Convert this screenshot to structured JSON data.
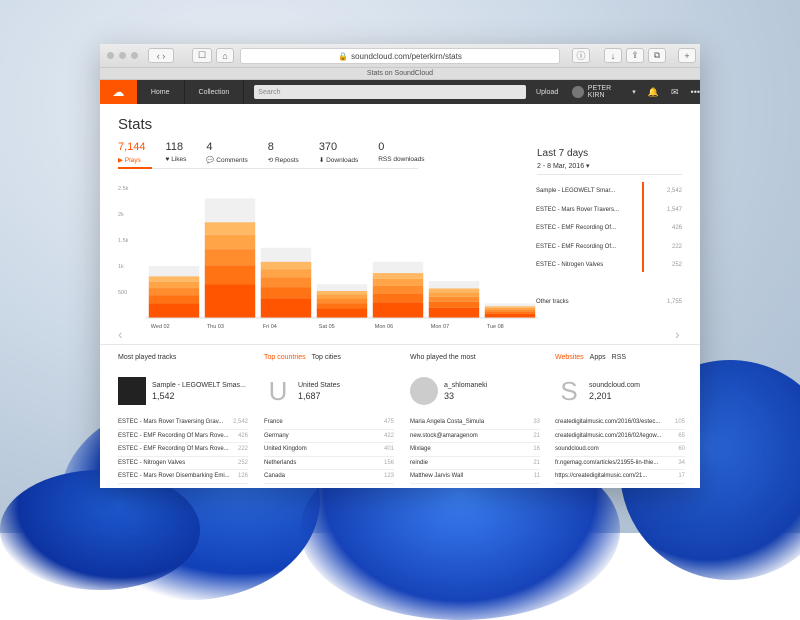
{
  "browser": {
    "url": "soundcloud.com/peterkirn/stats",
    "tab_title": "Stats on SoundCloud"
  },
  "nav": {
    "home": "Home",
    "collection": "Collection",
    "search_placeholder": "Search",
    "upload": "Upload",
    "user": "PETER KIRN"
  },
  "stats": {
    "title": "Stats",
    "counts": [
      {
        "num": "7,144",
        "label": "▶ Plays"
      },
      {
        "num": "118",
        "label": "♥ Likes"
      },
      {
        "num": "4",
        "label": "💬 Comments"
      },
      {
        "num": "8",
        "label": "⟲ Reposts"
      },
      {
        "num": "370",
        "label": "⬇ Downloads"
      },
      {
        "num": "0",
        "label": "RSS downloads"
      }
    ],
    "range_title": "Last 7 days",
    "range_sub": "2 - 8 Mar, 2016 ▾"
  },
  "chart_data": {
    "type": "bar",
    "categories": [
      "Wed 02",
      "Thu 03",
      "Fri 04",
      "Sat 05",
      "Mon 06",
      "Mon 07",
      "Tue 08"
    ],
    "series": [
      {
        "values": [
          1000,
          2300,
          1350,
          650,
          1080,
          710,
          280
        ]
      }
    ],
    "yticks": [
      "500",
      "1k",
      "1.5k",
      "2k",
      "2.5k"
    ],
    "ylim": [
      0,
      2500
    ],
    "colors": [
      "#ff5500",
      "#ff7315",
      "#ff8d2d",
      "#ffa447",
      "#ffb864",
      "#f0f0f0"
    ]
  },
  "track_breakdown": [
    {
      "name": "Sample - LEGOWELT Smar...",
      "value": "2,542"
    },
    {
      "name": "ESTEC - Mars Rover Travers...",
      "value": "1,547"
    },
    {
      "name": "ESTEC - EMF Recording Of...",
      "value": "426"
    },
    {
      "name": "ESTEC - EMF Recording Of...",
      "value": "222"
    },
    {
      "name": "ESTEC - Nitrogen Valves",
      "value": "252"
    },
    {
      "name": "Other tracks",
      "value": "1,755"
    }
  ],
  "most_played": {
    "header": "Most played tracks",
    "top_name": "Sample - LEGOWELT Smas...",
    "top_value": "1,542",
    "rows": [
      {
        "name": "ESTEC - Mars Rover Traversing Grav...",
        "value": "2,542"
      },
      {
        "name": "ESTEC - EMF Recording Of Mars Rove...",
        "value": "426"
      },
      {
        "name": "ESTEC - EMF Recording Of Mars Rove...",
        "value": "222"
      },
      {
        "name": "ESTEC - Nitrogen Valves",
        "value": "252"
      },
      {
        "name": "ESTEC - Mars Rover Disembarking Emi...",
        "value": "126"
      }
    ]
  },
  "countries": {
    "tab_active": "Top countries",
    "tab_other": "Top cities",
    "letter": "U",
    "top_name": "United States",
    "top_value": "1,687",
    "rows": [
      {
        "name": "France",
        "value": "475"
      },
      {
        "name": "Germany",
        "value": "422"
      },
      {
        "name": "United Kingdom",
        "value": "401"
      },
      {
        "name": "Netherlands",
        "value": "156"
      },
      {
        "name": "Canada",
        "value": "123"
      }
    ]
  },
  "who_played": {
    "header": "Who played the most",
    "top_name": "a_shlomaneki",
    "top_value": "33",
    "rows": [
      {
        "name": "Maria Angela Costa_Simula",
        "value": "33"
      },
      {
        "name": "new.stock@amaragenom",
        "value": "21"
      },
      {
        "name": "Mixlage",
        "value": "16"
      },
      {
        "name": "reindie",
        "value": "21"
      },
      {
        "name": "Matthew Jarvis Wall",
        "value": "11"
      }
    ]
  },
  "websites": {
    "tab_active": "Websites",
    "tab_apps": "Apps",
    "tab_rss": "RSS",
    "letter": "S",
    "top_name": "soundcloud.com",
    "top_value": "2,201",
    "rows": [
      {
        "name": "createdigitalmusic.com/2016/03/estec...",
        "value": "105"
      },
      {
        "name": "createdigitalmusic.com/2016/02/legow...",
        "value": "65"
      },
      {
        "name": "soundcloud.com",
        "value": "60"
      },
      {
        "name": "fr.ngemag.com/articles/21955-lin-thie...",
        "value": "34"
      },
      {
        "name": "https://createdigitalmusic.com/21...",
        "value": "17"
      }
    ]
  }
}
